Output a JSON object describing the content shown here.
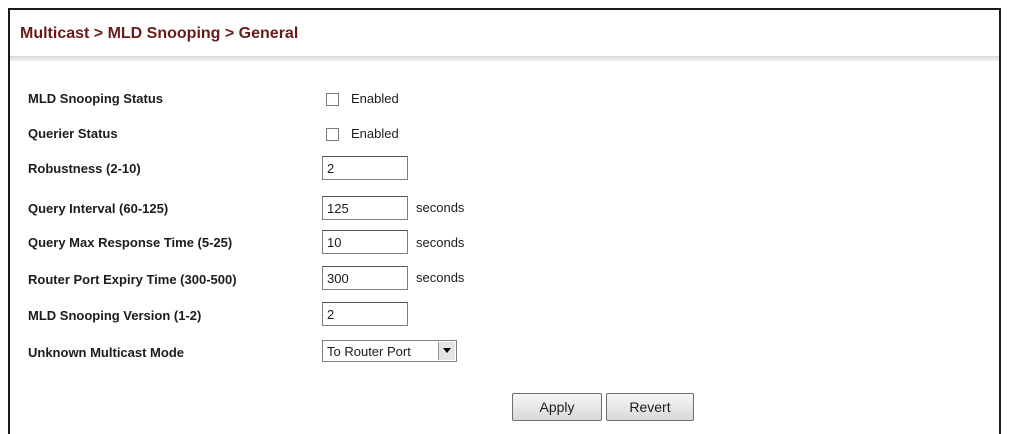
{
  "page": {
    "title": "Multicast > MLD Snooping > General"
  },
  "form": {
    "mld_snooping_status": {
      "label": "MLD Snooping Status",
      "checkbox_label": "Enabled",
      "checked": false
    },
    "querier_status": {
      "label": "Querier Status",
      "checkbox_label": "Enabled",
      "checked": false
    },
    "robustness": {
      "label": "Robustness (2-10)",
      "value": "2"
    },
    "query_interval": {
      "label": "Query Interval (60-125)",
      "value": "125",
      "unit": "seconds"
    },
    "query_max_response_time": {
      "label": "Query Max Response Time (5-25)",
      "value": "10",
      "unit": "seconds"
    },
    "router_port_expiry_time": {
      "label": "Router Port Expiry Time (300-500)",
      "value": "300",
      "unit": "seconds"
    },
    "mld_snooping_version": {
      "label": "MLD Snooping Version (1-2)",
      "value": "2"
    },
    "unknown_multicast_mode": {
      "label": "Unknown Multicast Mode",
      "selected": "To Router Port"
    }
  },
  "buttons": {
    "apply": "Apply",
    "revert": "Revert"
  }
}
